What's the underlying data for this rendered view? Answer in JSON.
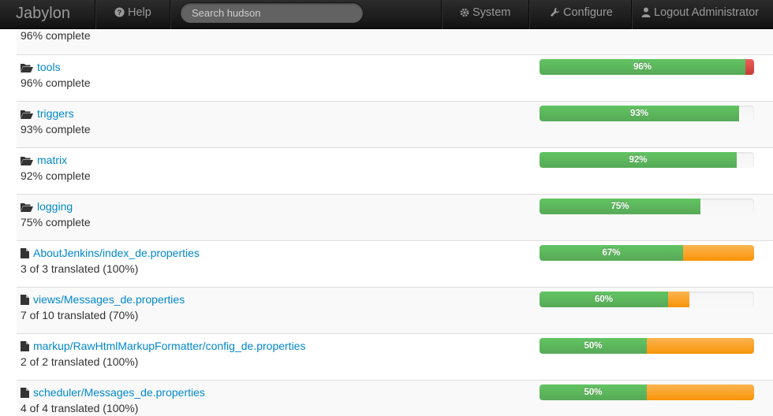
{
  "navbar": {
    "brand": "Jabylon",
    "help": "Help",
    "search_placeholder": "Search hudson",
    "system": "System",
    "configure": "Configure",
    "logout": "Logout Administrator"
  },
  "colors": {
    "complete": "#5eb95e",
    "missing": "#f89406",
    "error": "#dd514c",
    "link": "#0088cc"
  },
  "rows": [
    {
      "icon": "none",
      "label": "",
      "status": "96% complete",
      "complete": 96,
      "missing": 0,
      "error": 0,
      "percent_label": ""
    },
    {
      "icon": "folder-open-icon",
      "label": "tools",
      "status": "96% complete",
      "complete": 96,
      "missing": 0,
      "error": 4,
      "percent_label": "96%"
    },
    {
      "icon": "folder-open-icon",
      "label": "triggers",
      "status": "93% complete",
      "complete": 93,
      "missing": 0,
      "error": 0,
      "percent_label": "93%"
    },
    {
      "icon": "folder-open-icon",
      "label": "matrix",
      "status": "92% complete",
      "complete": 92,
      "missing": 0,
      "error": 0,
      "percent_label": "92%"
    },
    {
      "icon": "folder-open-icon",
      "label": "logging",
      "status": "75% complete",
      "complete": 75,
      "missing": 0,
      "error": 0,
      "percent_label": "75%"
    },
    {
      "icon": "file-icon",
      "label": "AboutJenkins/index_de.properties",
      "status": "3 of 3 translated (100%)",
      "complete": 67,
      "missing": 33,
      "error": 0,
      "percent_label": "67%"
    },
    {
      "icon": "file-icon",
      "label": "views/Messages_de.properties",
      "status": "7 of 10 translated (70%)",
      "complete": 60,
      "missing": 10,
      "error": 0,
      "percent_label": "60%"
    },
    {
      "icon": "file-icon",
      "label": "markup/RawHtmlMarkupFormatter/config_de.properties",
      "status": "2 of 2 translated (100%)",
      "complete": 50,
      "missing": 50,
      "error": 0,
      "percent_label": "50%"
    },
    {
      "icon": "file-icon",
      "label": "scheduler/Messages_de.properties",
      "status": "4 of 4 translated (100%)",
      "complete": 50,
      "missing": 50,
      "error": 0,
      "percent_label": "50%"
    }
  ]
}
